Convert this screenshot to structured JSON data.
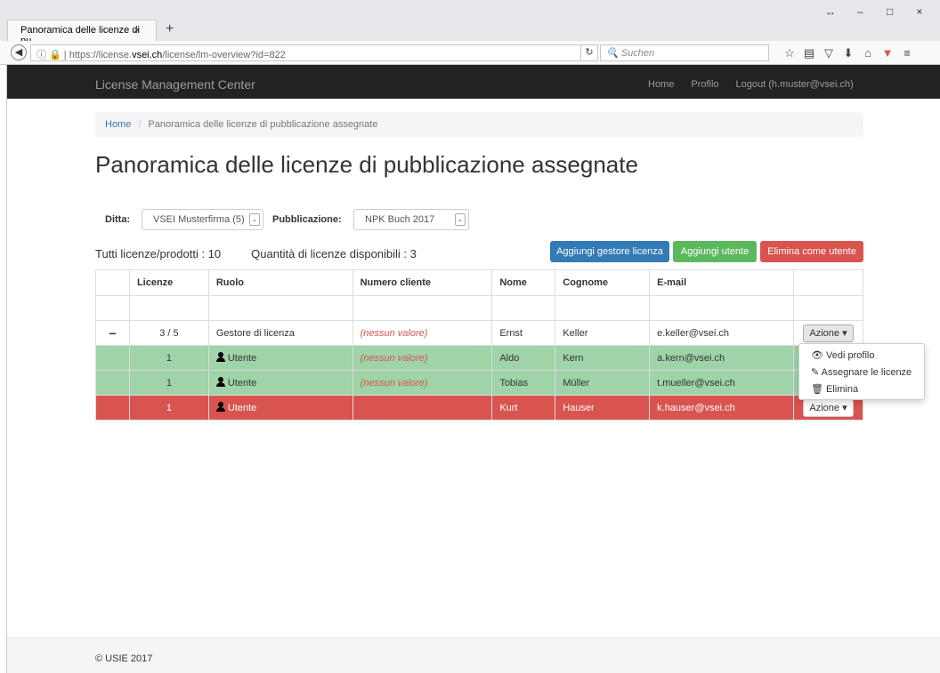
{
  "browser": {
    "tab_title": "Panoramica delle licenze di pu...",
    "tab_close": "×",
    "new_tab": "+",
    "url_prefix": "https://license.",
    "url_domain": "vsei.ch",
    "url_suffix": "/license/lm-overview?id=822",
    "search_placeholder": "Suchen",
    "window_controls": [
      "↔",
      "–",
      "□",
      "×"
    ]
  },
  "app": {
    "brand": "License Management Center",
    "nav": {
      "home": "Home",
      "profile": "Profilo",
      "logout": "Logout (h.muster@vsei.ch)"
    }
  },
  "breadcrumb": {
    "home": "Home",
    "sep": "/",
    "current": "Panoramica delle licenze di pubblicazione assegnate"
  },
  "page_title": "Panoramica delle licenze di pubblicazione assegnate",
  "filters": {
    "ditta_label": "Ditta",
    "ditta_value": "VSEI Musterfirma (5)",
    "pubblicazione_label": "Pubblicazione",
    "pubblicazione_value": "NPK Buch 2017"
  },
  "counts": {
    "total": "Tutti licenze/prodotti : 10",
    "available": "Quantità di licenze disponibili : 3"
  },
  "buttons": {
    "add_manager": "Aggiungi gestore licenza",
    "add_user": "Aggiungi utente",
    "remove_user": "Elimina come utente"
  },
  "table": {
    "headers": [
      "",
      "Licenze",
      "Ruolo",
      "Numero cliente",
      "Nome",
      "Cognome",
      "E-mail",
      ""
    ],
    "rows": [
      {
        "toggle": "−",
        "licenze": "3 / 5",
        "ruolo": "Gestore di licenza",
        "numero": "(nessun valore)",
        "nome": "Ernst",
        "cognome": "Keller",
        "email": "e.keller@vsei.ch",
        "azione": "Azione ▾"
      },
      {
        "licenze": "1",
        "ruolo": "Utente",
        "numero": "(nessun valore)",
        "nome": "Aldo",
        "cognome": "Kern",
        "email": "a.kern@vsei.ch"
      },
      {
        "licenze": "1",
        "ruolo": "Utente",
        "numero": "(nessun valore)",
        "nome": "Tobias",
        "cognome": "Müller",
        "email": "t.mueller@vsei.ch"
      },
      {
        "licenze": "1",
        "ruolo": "Utente",
        "numero": "",
        "nome": "Kurt",
        "cognome": "Hauser",
        "email": "k.hauser@vsei.ch",
        "azione": "Azione ▾"
      }
    ]
  },
  "dropdown": {
    "view_profile": "Vedi profilo",
    "assign": "Assegnare le licenze",
    "delete": "Elimina"
  },
  "footer": {
    "copyright": "© USIE 2017"
  },
  "colors": {
    "navbar": "#222222",
    "primary": "#337ab7",
    "success": "#5cb85c",
    "danger": "#d9534f",
    "row_green": "#9fd3a8"
  }
}
